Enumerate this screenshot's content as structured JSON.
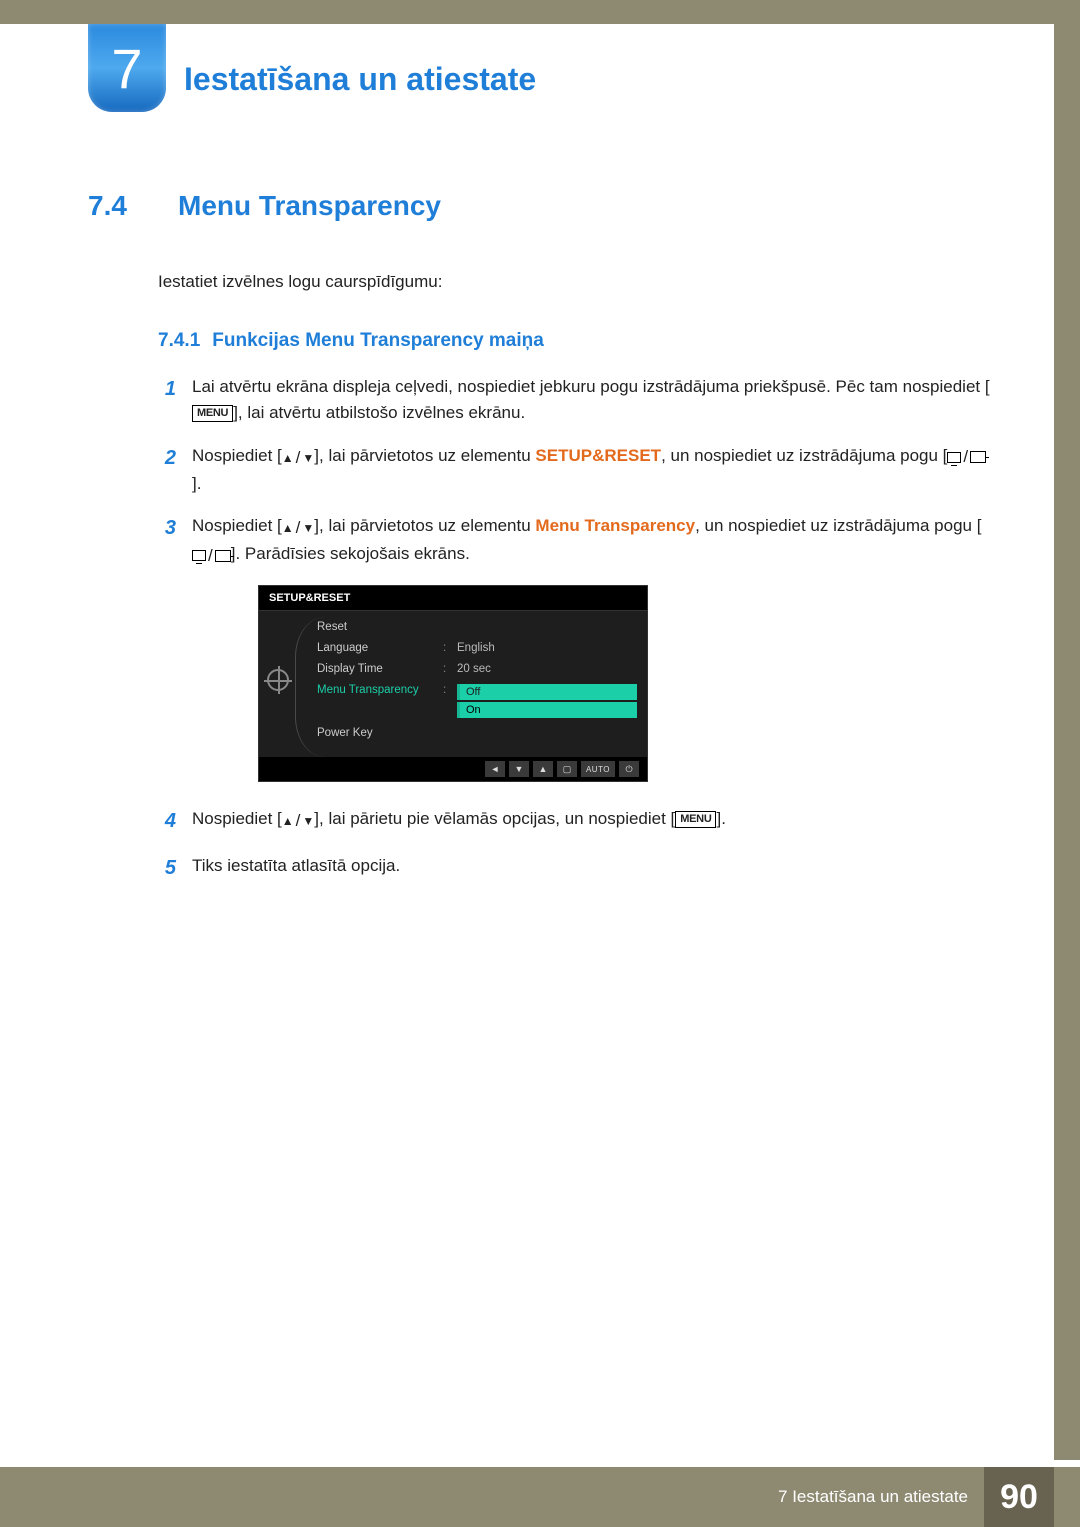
{
  "chapter": {
    "number": "7",
    "title": "Iestatīšana un atiestate"
  },
  "section": {
    "number": "7.4",
    "title": "Menu Transparency",
    "intro": "Iestatiet izvēlnes logu caurspīdīgumu:"
  },
  "subsection": {
    "number": "7.4.1",
    "title": "Funkcijas Menu Transparency maiņa"
  },
  "steps": {
    "s1": {
      "num": "1",
      "t1": "Lai atvērtu ekrāna displeja ceļvedi, nospiediet jebkuru pogu izstrādājuma priekšpusē. Pēc tam nospiediet [",
      "menu": "MENU",
      "t2": "], lai atvērtu atbilstošo izvēlnes ekrānu."
    },
    "s2": {
      "num": "2",
      "t1": "Nospiediet [",
      "t2": "], lai pārvietotos uz elementu ",
      "hl": "SETUP&RESET",
      "t3": ", un nospiediet uz izstrādājuma pogu [",
      "t4": "]."
    },
    "s3": {
      "num": "3",
      "t1": "Nospiediet [",
      "t2": "], lai pārvietotos uz elementu ",
      "hl": "Menu Transparency",
      "t3": ", un nospiediet uz izstrādājuma pogu [",
      "t4": "]. Parādīsies sekojošais ekrāns."
    },
    "s4": {
      "num": "4",
      "t1": "Nospiediet [",
      "t2": "], lai pārietu pie vēlamās opcijas, un nospiediet [",
      "menu": "MENU",
      "t3": "]."
    },
    "s5": {
      "num": "5",
      "t1": "Tiks iestatīta atlasītā opcija."
    }
  },
  "osd": {
    "title": "SETUP&RESET",
    "rows": {
      "reset": "Reset",
      "language": {
        "label": "Language",
        "value": "English"
      },
      "display_time": {
        "label": "Display Time",
        "value": "20 sec"
      },
      "menu_transparency": {
        "label": "Menu Transparency",
        "opt1": "Off",
        "opt2": "On"
      },
      "power_key": "Power Key"
    },
    "footer": {
      "auto": "AUTO"
    }
  },
  "footer": {
    "label": "7 Iestatīšana un atiestate",
    "page": "90"
  }
}
